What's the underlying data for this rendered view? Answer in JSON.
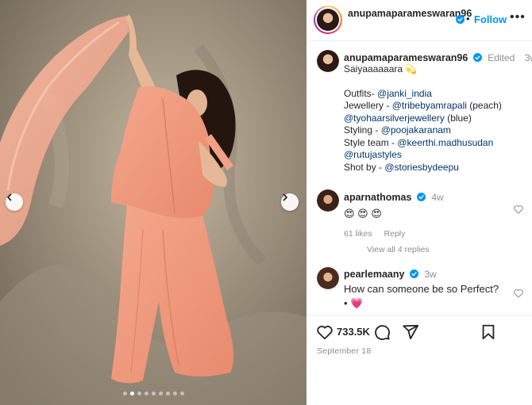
{
  "post": {
    "username": "anupamaparameswaran96",
    "follow_label": "Follow",
    "separator": "•",
    "more_label": "•••",
    "image_count": 9,
    "active_image": 2
  },
  "caption": {
    "username": "anupamaparameswaran96",
    "edited": "Edited",
    "time": "3w",
    "lines": [
      {
        "text": "Saiyaaaaaara 💫"
      },
      {
        "text": ""
      },
      {
        "text": "Outfits- ",
        "mention": "@janki_india"
      },
      {
        "text": "Jewellery - ",
        "mention": "@tribebyamrapali",
        "after": " (peach)"
      },
      {
        "text": "",
        "mention": "@tyohaarsilverjewellery",
        "after": " (blue)"
      },
      {
        "text": "Styling - ",
        "mention": "@poojakaranam"
      },
      {
        "text": "Style team - ",
        "mention": "@keerthi.madhusudan"
      },
      {
        "text": "",
        "mention": "@rutujastyles"
      },
      {
        "text": "Shot by - ",
        "mention": "@storiesbydeepu"
      }
    ]
  },
  "comments": [
    {
      "username": "aparnathomas",
      "time": "4w",
      "text": "😍 😍 😍",
      "likes": "61 likes",
      "reply": "Reply",
      "view_replies": "View all 4 replies"
    },
    {
      "username": "pearlemaany",
      "time": "3w",
      "text": "How can someone be so Perfect?",
      "text2": "• 💗"
    }
  ],
  "actions": {
    "like_count": "733.5K",
    "date": "September 18"
  },
  "colors": {
    "accent": "#0095f6",
    "verified": "#0095f6",
    "mention": "#00376b",
    "muted": "#8e8e8e"
  }
}
